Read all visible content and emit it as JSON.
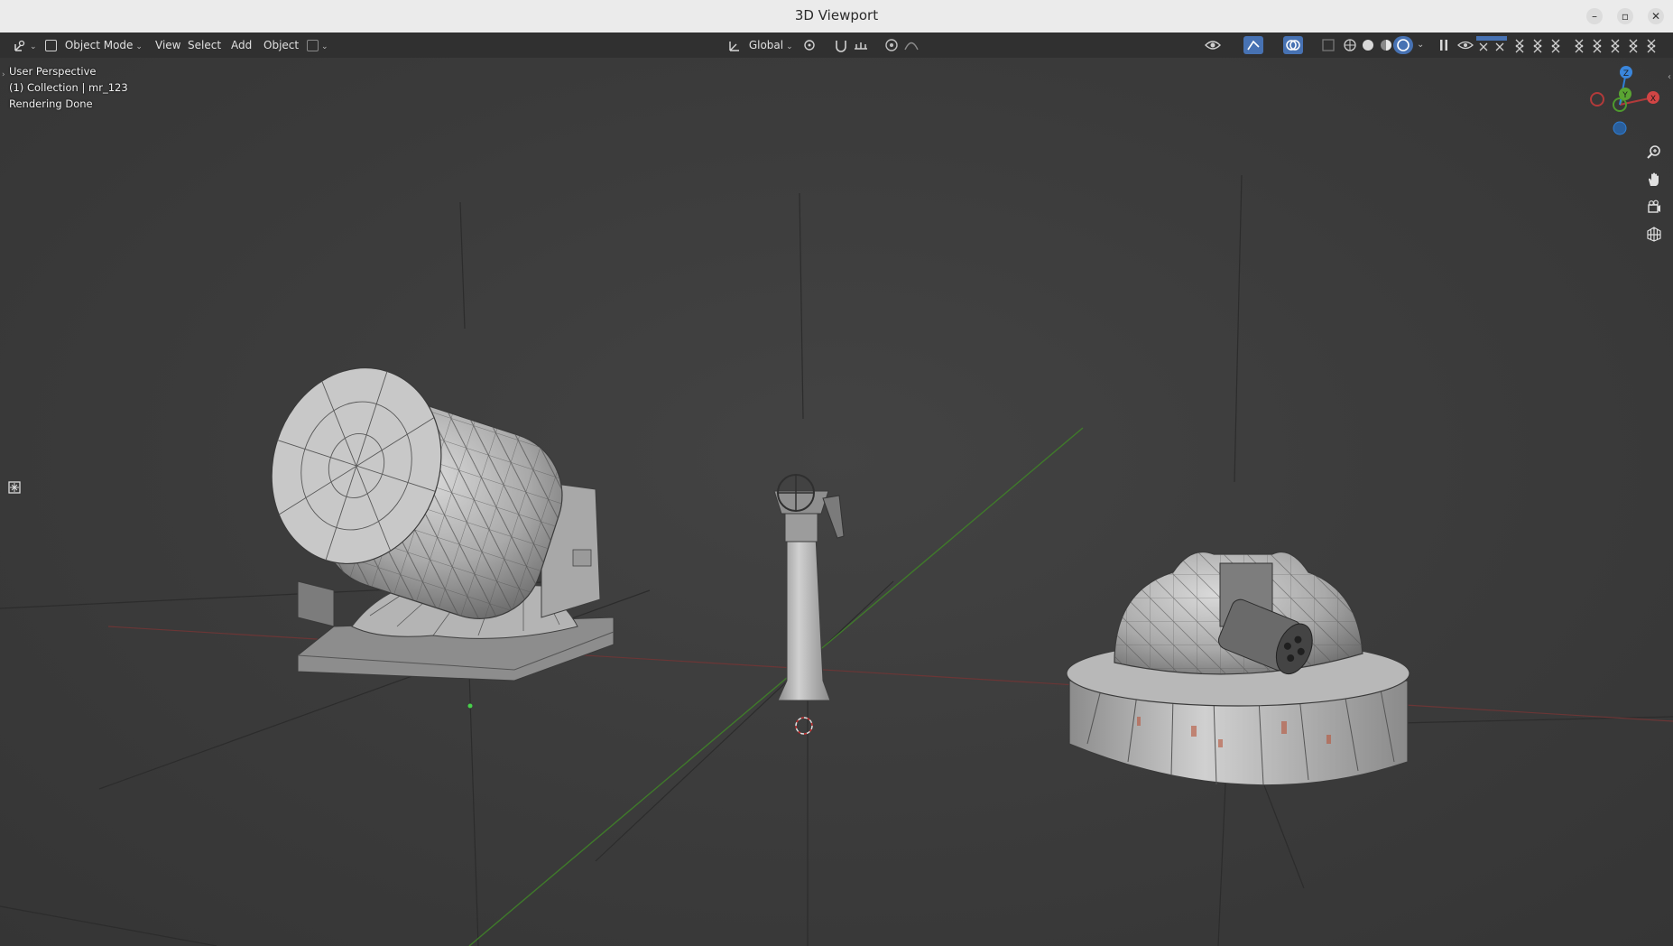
{
  "window": {
    "title": "3D Viewport",
    "controls": [
      "minimize",
      "restore",
      "close"
    ]
  },
  "header": {
    "editor_type_icon": "editor-type-icon",
    "mode": {
      "label": "Object Mode",
      "icon": "object-mode-icon"
    },
    "menus": [
      "View",
      "Select",
      "Add",
      "Object"
    ],
    "transform_orientation": "Global",
    "icons_right": [
      "visibility-icon",
      "gizmo-icon",
      "overlay-icon",
      "xray-icon",
      "wireframe-shading-icon",
      "solid-shading-icon",
      "material-shading-icon",
      "rendered-shading-icon",
      "pause-icon"
    ]
  },
  "viewport": {
    "info": {
      "perspective": "User Perspective",
      "collection": "(1) Collection | mr_123",
      "status": "Rendering Done"
    },
    "gizmo": {
      "z": "Z",
      "y": "Y",
      "x": "X"
    },
    "nav_buttons": [
      "zoom-icon",
      "pan-hand-icon",
      "camera-view-icon",
      "ortho-grid-icon"
    ],
    "objects": [
      "searchlight-model",
      "mast-model",
      "gun-turret-model"
    ],
    "colors": {
      "x_axis": "#b23a3a",
      "y_axis": "#4e9a2e",
      "z_axis": "#2f7fd6",
      "grid": "#2e2e2e"
    }
  }
}
